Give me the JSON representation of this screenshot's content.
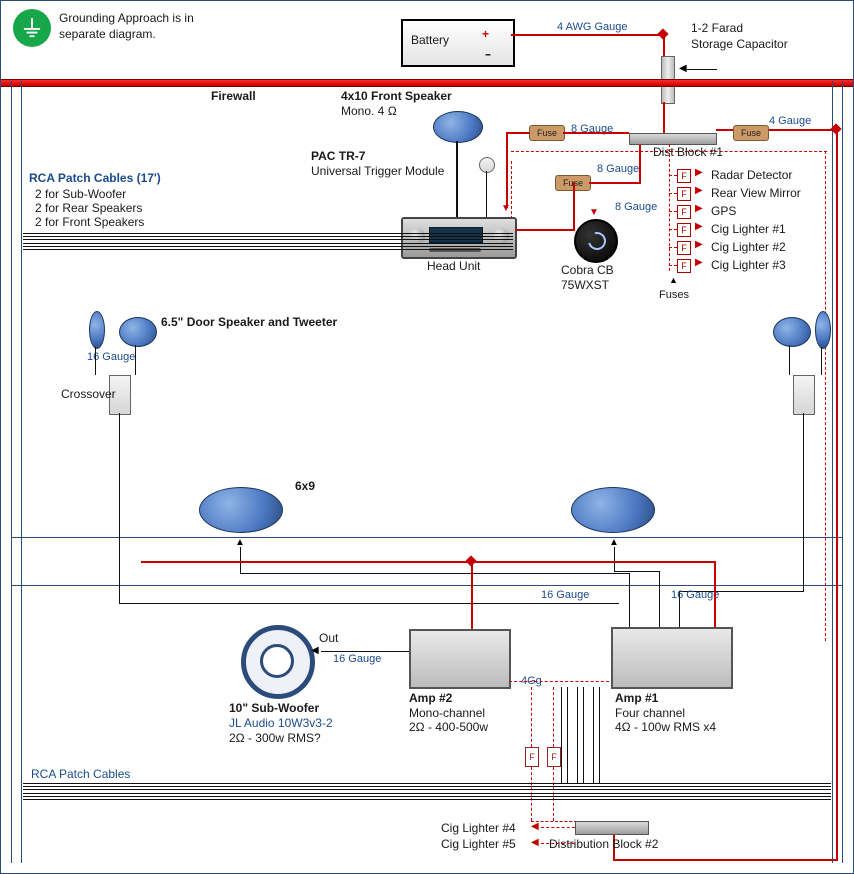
{
  "header": {
    "grounding_note_1": "Grounding Approach is in",
    "grounding_note_2": "separate diagram.",
    "battery_label": "Battery",
    "battery_plus": "+",
    "battery_minus": "--",
    "awg4_label": "4 AWG Gauge",
    "capacitor_line1": "1-2 Farad",
    "capacitor_line2": "Storage Capacitor"
  },
  "firewall_label": "Firewall",
  "front_speaker": {
    "title": "4x10 Front Speaker",
    "sub": "Mono. 4 Ω"
  },
  "pac": {
    "title": "PAC TR-7",
    "sub": "Universal Trigger Module"
  },
  "rca_cables": {
    "title": "RCA Patch Cables (17')",
    "l1": "2 for Sub-Woofer",
    "l2": "2 for Rear Speakers",
    "l3": "2 for Front Speakers"
  },
  "wire_gauges": {
    "g8a": "8 Gauge",
    "g8b": "8 Gauge",
    "g8c": "8 Gauge",
    "g4": "4 Gauge",
    "g16a": "16 Gauge",
    "g16b": "16 Gauge",
    "g16c": "16 Gauge",
    "g16d": "16 Gauge",
    "g4gg": "4Gg"
  },
  "fuse_text": "Fuse",
  "dist1_label": "Dist Block #1",
  "accessories": {
    "radar": "Radar Detector",
    "mirror": "Rear View Mirror",
    "gps": "GPS",
    "cig1": "Cig Lighter #1",
    "cig2": "Cig Lighter #2",
    "cig3": "Cig Lighter #3",
    "fuses_label": "Fuses",
    "fuse_letter": "F"
  },
  "head_unit_label": "Head Unit",
  "cobra": {
    "l1": "Cobra CB",
    "l2": "75WXST"
  },
  "door_spk_title": "6.5\" Door Speaker and Tweeter",
  "crossover_label": "Crossover",
  "sixby9": "6x9",
  "sub": {
    "title": "10\" Sub-Woofer",
    "model": "JL Audio 10W3v3-2",
    "spec": "2Ω - 300w RMS?",
    "out": "Out"
  },
  "amp2": {
    "title": "Amp #2",
    "l1": "Mono-channel",
    "l2": "2Ω - 400-500w"
  },
  "amp1": {
    "title": "Amp #1",
    "l1": "Four channel",
    "l2": "4Ω - 100w RMS x4"
  },
  "rca_bottom_label": "RCA Patch Cables",
  "dist2_label": "Distribution Block #2",
  "cig4": "Cig Lighter #4",
  "cig5": "Cig Lighter #5",
  "f_letter": "F"
}
